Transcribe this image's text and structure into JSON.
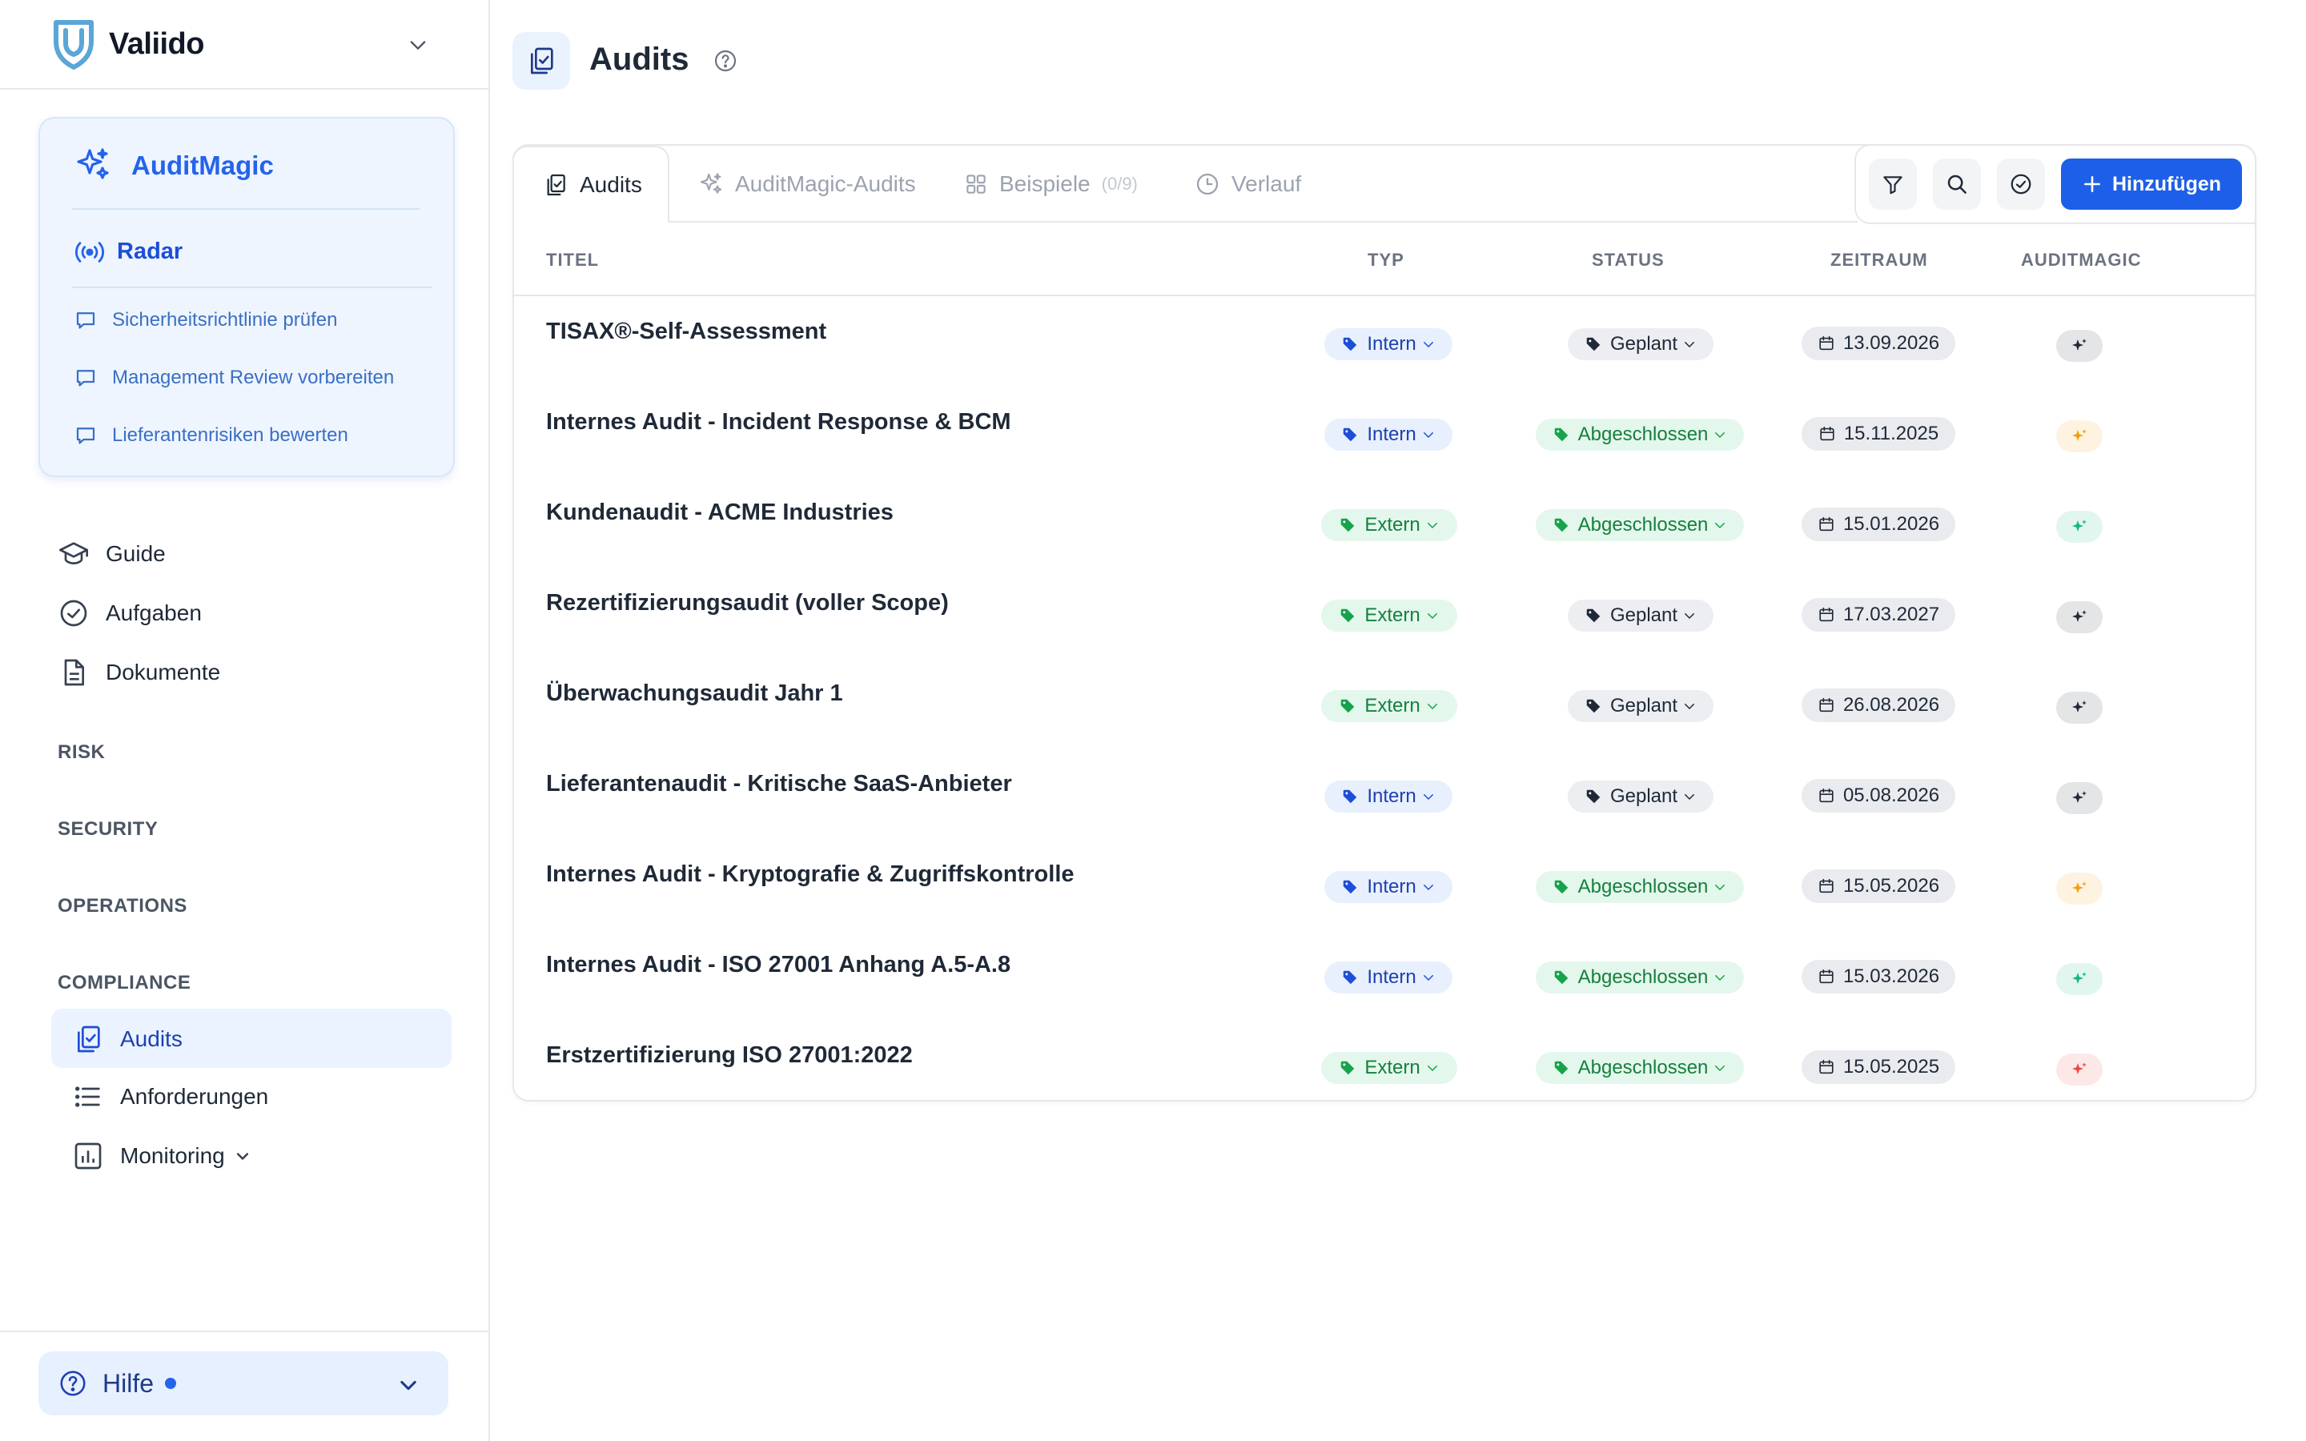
{
  "brand": {
    "name": "Valiido"
  },
  "auditmagic": {
    "title": "AuditMagic",
    "radar": "Radar",
    "prompts": [
      "Sicherheitsrichtlinie prüfen",
      "Management Review vorbereiten",
      "Lieferantenrisiken bewerten"
    ]
  },
  "nav": {
    "guide": "Guide",
    "aufgaben": "Aufgaben",
    "dokumente": "Dokumente",
    "sections": {
      "risk": "RISK",
      "security": "SECURITY",
      "operations": "OPERATIONS",
      "compliance": "COMPLIANCE"
    },
    "audits": "Audits",
    "anforderungen": "Anforderungen",
    "monitoring": "Monitoring"
  },
  "help": {
    "label": "Hilfe"
  },
  "page": {
    "title": "Audits"
  },
  "tabs": {
    "audits": "Audits",
    "auditmagic_audits": "AuditMagic-Audits",
    "beispiele": "Beispiele",
    "beispiele_count": "(0/9)",
    "verlauf": "Verlauf"
  },
  "toolbar": {
    "add_label": "Hinzufügen"
  },
  "table": {
    "headers": {
      "titel": "TITEL",
      "typ": "TYP",
      "status": "STATUS",
      "zeitraum": "ZEITRAUM",
      "auditmagic": "AUDITMAGIC"
    },
    "rows": [
      {
        "title": "TISAX®-Self-Assessment",
        "typ": "Intern",
        "status": "Geplant",
        "date": "13.09.2026",
        "magic": "#1f2937"
      },
      {
        "title": "Internes Audit - Incident Response & BCM",
        "typ": "Intern",
        "status": "Abgeschlossen",
        "date": "15.11.2025",
        "magic": "#f59e0b"
      },
      {
        "title": "Kundenaudit - ACME Industries",
        "typ": "Extern",
        "status": "Abgeschlossen",
        "date": "15.01.2026",
        "magic": "#10b981"
      },
      {
        "title": "Rezertifizierungsaudit (voller Scope)",
        "typ": "Extern",
        "status": "Geplant",
        "date": "17.03.2027",
        "magic": "#1f2937"
      },
      {
        "title": "Überwachungsaudit Jahr 1",
        "typ": "Extern",
        "status": "Geplant",
        "date": "26.08.2026",
        "magic": "#1f2937"
      },
      {
        "title": "Lieferantenaudit - Kritische SaaS-Anbieter",
        "typ": "Intern",
        "status": "Geplant",
        "date": "05.08.2026",
        "magic": "#1f2937"
      },
      {
        "title": "Internes Audit - Kryptografie & Zugriffskontrolle",
        "typ": "Intern",
        "status": "Abgeschlossen",
        "date": "15.05.2026",
        "magic": "#f59e0b"
      },
      {
        "title": "Internes Audit - ISO 27001 Anhang A.5-A.8",
        "typ": "Intern",
        "status": "Abgeschlossen",
        "date": "15.03.2026",
        "magic": "#10b981"
      },
      {
        "title": "Erstzertifizierung ISO 27001:2022",
        "typ": "Extern",
        "status": "Abgeschlossen",
        "date": "15.05.2025",
        "magic": "#ef4444"
      }
    ]
  },
  "colors": {
    "accent": "#1d5fe8",
    "intern": "#1e40af",
    "extern": "#15803d"
  }
}
